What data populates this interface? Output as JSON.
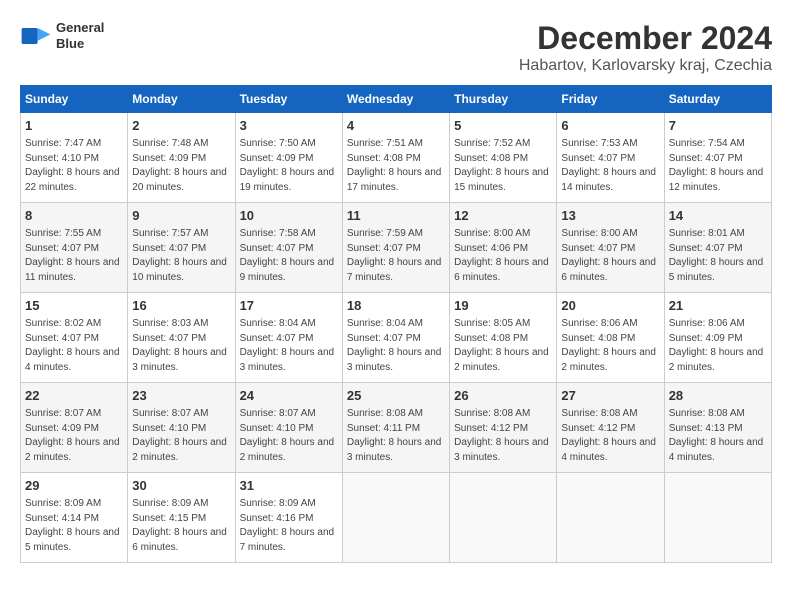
{
  "logo": {
    "line1": "General",
    "line2": "Blue"
  },
  "title": "December 2024",
  "subtitle": "Habartov, Karlovarsky kraj, Czechia",
  "weekdays": [
    "Sunday",
    "Monday",
    "Tuesday",
    "Wednesday",
    "Thursday",
    "Friday",
    "Saturday"
  ],
  "weeks": [
    [
      {
        "day": "1",
        "sunrise": "7:47 AM",
        "sunset": "4:10 PM",
        "daylight": "8 hours and 22 minutes."
      },
      {
        "day": "2",
        "sunrise": "7:48 AM",
        "sunset": "4:09 PM",
        "daylight": "8 hours and 20 minutes."
      },
      {
        "day": "3",
        "sunrise": "7:50 AM",
        "sunset": "4:09 PM",
        "daylight": "8 hours and 19 minutes."
      },
      {
        "day": "4",
        "sunrise": "7:51 AM",
        "sunset": "4:08 PM",
        "daylight": "8 hours and 17 minutes."
      },
      {
        "day": "5",
        "sunrise": "7:52 AM",
        "sunset": "4:08 PM",
        "daylight": "8 hours and 15 minutes."
      },
      {
        "day": "6",
        "sunrise": "7:53 AM",
        "sunset": "4:07 PM",
        "daylight": "8 hours and 14 minutes."
      },
      {
        "day": "7",
        "sunrise": "7:54 AM",
        "sunset": "4:07 PM",
        "daylight": "8 hours and 12 minutes."
      }
    ],
    [
      {
        "day": "8",
        "sunrise": "7:55 AM",
        "sunset": "4:07 PM",
        "daylight": "8 hours and 11 minutes."
      },
      {
        "day": "9",
        "sunrise": "7:57 AM",
        "sunset": "4:07 PM",
        "daylight": "8 hours and 10 minutes."
      },
      {
        "day": "10",
        "sunrise": "7:58 AM",
        "sunset": "4:07 PM",
        "daylight": "8 hours and 9 minutes."
      },
      {
        "day": "11",
        "sunrise": "7:59 AM",
        "sunset": "4:07 PM",
        "daylight": "8 hours and 7 minutes."
      },
      {
        "day": "12",
        "sunrise": "8:00 AM",
        "sunset": "4:06 PM",
        "daylight": "8 hours and 6 minutes."
      },
      {
        "day": "13",
        "sunrise": "8:00 AM",
        "sunset": "4:07 PM",
        "daylight": "8 hours and 6 minutes."
      },
      {
        "day": "14",
        "sunrise": "8:01 AM",
        "sunset": "4:07 PM",
        "daylight": "8 hours and 5 minutes."
      }
    ],
    [
      {
        "day": "15",
        "sunrise": "8:02 AM",
        "sunset": "4:07 PM",
        "daylight": "8 hours and 4 minutes."
      },
      {
        "day": "16",
        "sunrise": "8:03 AM",
        "sunset": "4:07 PM",
        "daylight": "8 hours and 3 minutes."
      },
      {
        "day": "17",
        "sunrise": "8:04 AM",
        "sunset": "4:07 PM",
        "daylight": "8 hours and 3 minutes."
      },
      {
        "day": "18",
        "sunrise": "8:04 AM",
        "sunset": "4:07 PM",
        "daylight": "8 hours and 3 minutes."
      },
      {
        "day": "19",
        "sunrise": "8:05 AM",
        "sunset": "4:08 PM",
        "daylight": "8 hours and 2 minutes."
      },
      {
        "day": "20",
        "sunrise": "8:06 AM",
        "sunset": "4:08 PM",
        "daylight": "8 hours and 2 minutes."
      },
      {
        "day": "21",
        "sunrise": "8:06 AM",
        "sunset": "4:09 PM",
        "daylight": "8 hours and 2 minutes."
      }
    ],
    [
      {
        "day": "22",
        "sunrise": "8:07 AM",
        "sunset": "4:09 PM",
        "daylight": "8 hours and 2 minutes."
      },
      {
        "day": "23",
        "sunrise": "8:07 AM",
        "sunset": "4:10 PM",
        "daylight": "8 hours and 2 minutes."
      },
      {
        "day": "24",
        "sunrise": "8:07 AM",
        "sunset": "4:10 PM",
        "daylight": "8 hours and 2 minutes."
      },
      {
        "day": "25",
        "sunrise": "8:08 AM",
        "sunset": "4:11 PM",
        "daylight": "8 hours and 3 minutes."
      },
      {
        "day": "26",
        "sunrise": "8:08 AM",
        "sunset": "4:12 PM",
        "daylight": "8 hours and 3 minutes."
      },
      {
        "day": "27",
        "sunrise": "8:08 AM",
        "sunset": "4:12 PM",
        "daylight": "8 hours and 4 minutes."
      },
      {
        "day": "28",
        "sunrise": "8:08 AM",
        "sunset": "4:13 PM",
        "daylight": "8 hours and 4 minutes."
      }
    ],
    [
      {
        "day": "29",
        "sunrise": "8:09 AM",
        "sunset": "4:14 PM",
        "daylight": "8 hours and 5 minutes."
      },
      {
        "day": "30",
        "sunrise": "8:09 AM",
        "sunset": "4:15 PM",
        "daylight": "8 hours and 6 minutes."
      },
      {
        "day": "31",
        "sunrise": "8:09 AM",
        "sunset": "4:16 PM",
        "daylight": "8 hours and 7 minutes."
      },
      null,
      null,
      null,
      null
    ]
  ],
  "labels": {
    "sunrise": "Sunrise:",
    "sunset": "Sunset:",
    "daylight": "Daylight:"
  }
}
